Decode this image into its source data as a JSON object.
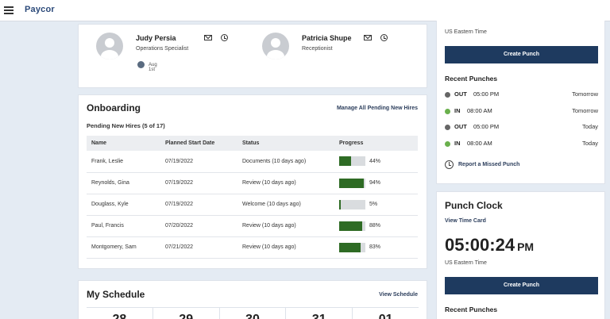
{
  "app": {
    "logo": "Paycor"
  },
  "team": {
    "people": [
      {
        "name": "Judy Persia",
        "title": "Operations Specialist",
        "event": "Aug 1st"
      },
      {
        "name": "Patricia Shupe",
        "title": "Receptionist"
      }
    ]
  },
  "onboarding": {
    "title": "Onboarding",
    "manage_link": "Manage All Pending New Hires",
    "subtitle": "Pending New Hires (5 of 17)",
    "columns": [
      "Name",
      "Planned Start Date",
      "Status",
      "Progress"
    ],
    "rows": [
      {
        "name": "Frank, Leslie",
        "date": "07/19/2022",
        "status": "Documents (10 days ago)",
        "progress": 44,
        "progress_label": "44%"
      },
      {
        "name": "Reynolds, Gina",
        "date": "07/19/2022",
        "status": "Review (10 days ago)",
        "progress": 94,
        "progress_label": "94%"
      },
      {
        "name": "Douglass, Kyle",
        "date": "07/19/2022",
        "status": "Welcome (10 days ago)",
        "progress": 5,
        "progress_label": "5%"
      },
      {
        "name": "Paul, Francis",
        "date": "07/20/2022",
        "status": "Review (10 days ago)",
        "progress": 88,
        "progress_label": "88%"
      },
      {
        "name": "Montgomery, Sam",
        "date": "07/21/2022",
        "status": "Review (10 days ago)",
        "progress": 83,
        "progress_label": "83%"
      }
    ]
  },
  "schedule": {
    "title": "My Schedule",
    "view_link": "View Schedule",
    "days": [
      "28",
      "29",
      "30",
      "31",
      "01"
    ]
  },
  "punch_top": {
    "timezone": "US Eastern Time",
    "button": "Create Punch",
    "recent_title": "Recent Punches",
    "punches": [
      {
        "dir": "OUT",
        "time": "05:00 PM",
        "day": "Tomorrow",
        "color": "#666666"
      },
      {
        "dir": "IN",
        "time": "08:00 AM",
        "day": "Tomorrow",
        "color": "#6ab04c"
      },
      {
        "dir": "OUT",
        "time": "05:00 PM",
        "day": "Today",
        "color": "#666666"
      },
      {
        "dir": "IN",
        "time": "08:00 AM",
        "day": "Today",
        "color": "#6ab04c"
      }
    ],
    "missed_link": "Report a Missed Punch"
  },
  "punch_clock": {
    "title": "Punch Clock",
    "view_link": "View Time Card",
    "time": "05:00:24",
    "ampm": "PM",
    "timezone": "US Eastern Time",
    "button": "Create Punch",
    "recent_title": "Recent Punches"
  },
  "colors": {
    "accent": "#1e3a5f",
    "progress": "#2e6b24",
    "background": "#e4ebf3"
  }
}
